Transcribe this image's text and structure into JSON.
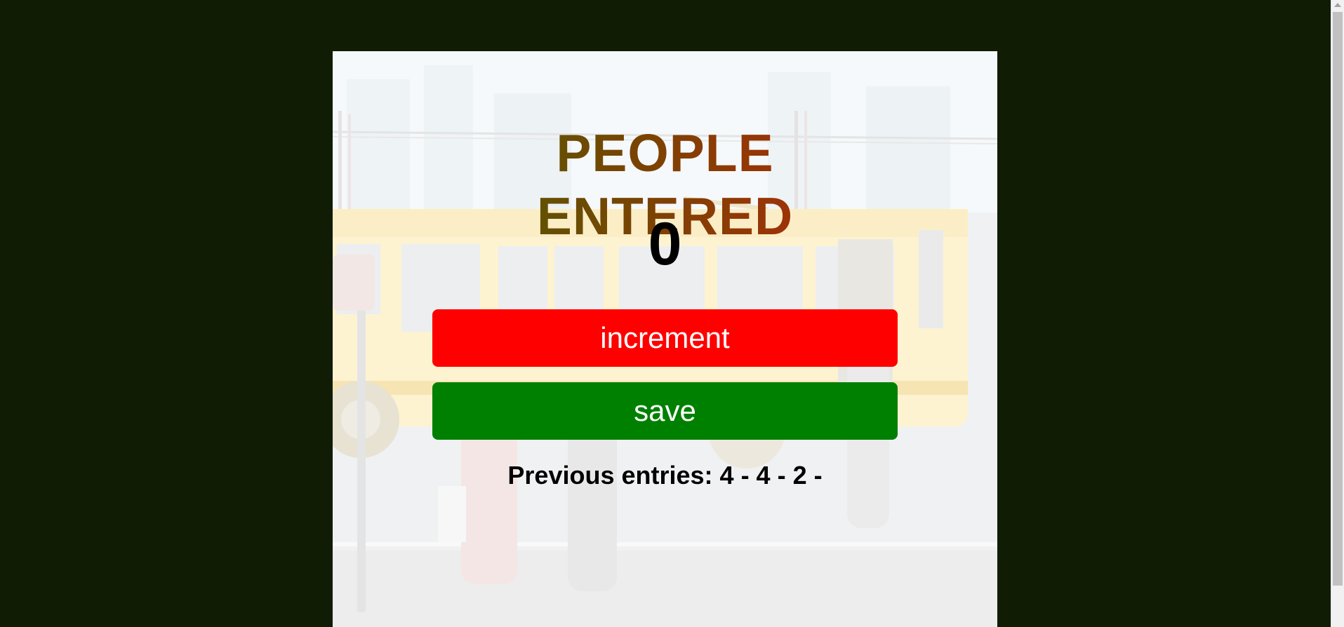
{
  "app": {
    "title": "PEOPLE ENTERED",
    "count": "0",
    "increment_label": "increment",
    "save_label": "save",
    "previous_label": "Previous entries:",
    "previous_entries": "4 - 4 - 2 -"
  },
  "colors": {
    "page_background": "#101c03",
    "increment_button": "#ff0000",
    "save_button": "#008000",
    "title_gradient_start": "#4a5f02",
    "title_gradient_end": "#b7270a"
  },
  "icons": {
    "background_image": "bus-stop-illustration"
  }
}
